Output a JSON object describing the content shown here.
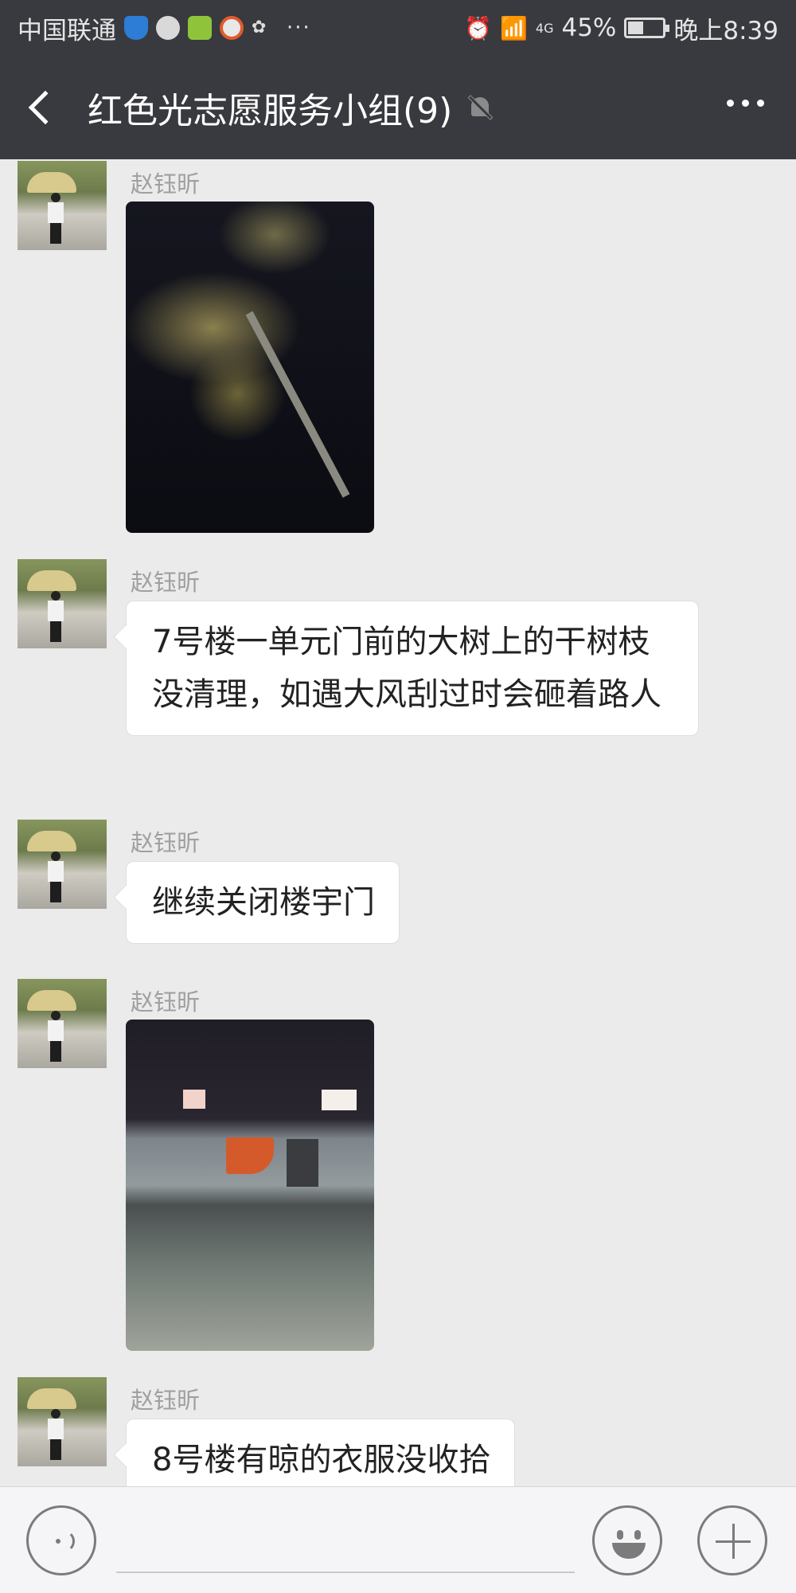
{
  "status_bar": {
    "carrier": "中国联通",
    "network": "4G",
    "battery": "45%",
    "time": "晚上8:39"
  },
  "header": {
    "title": "红色光志愿服务小组(9)"
  },
  "messages": [
    {
      "sender": "赵钰昕",
      "type": "image",
      "image_desc": "night tree photo"
    },
    {
      "sender": "赵钰昕",
      "type": "text",
      "text": "7号楼一单元门前的大树上的干树枝没清理，如遇大风刮过时会砸着路人"
    },
    {
      "sender": "赵钰昕",
      "type": "text",
      "text": "继续关闭楼宇门"
    },
    {
      "sender": "赵钰昕",
      "type": "image",
      "image_desc": "night building photo"
    },
    {
      "sender": "赵钰昕",
      "type": "text",
      "text": "8号楼有晾的衣服没收拾"
    }
  ],
  "input_bar": {
    "value": "",
    "placeholder": ""
  },
  "icons": {
    "back": "chevron-left-icon",
    "mute": "bell-slash-icon",
    "more": "ellipsis-icon",
    "voice": "voice-icon",
    "emoji": "smiley-icon",
    "plus": "plus-icon"
  },
  "colors": {
    "header_bg": "#393a3f",
    "chat_bg": "#ebebeb",
    "bubble_bg": "#ffffff",
    "sender_text": "#a0a0a0"
  }
}
